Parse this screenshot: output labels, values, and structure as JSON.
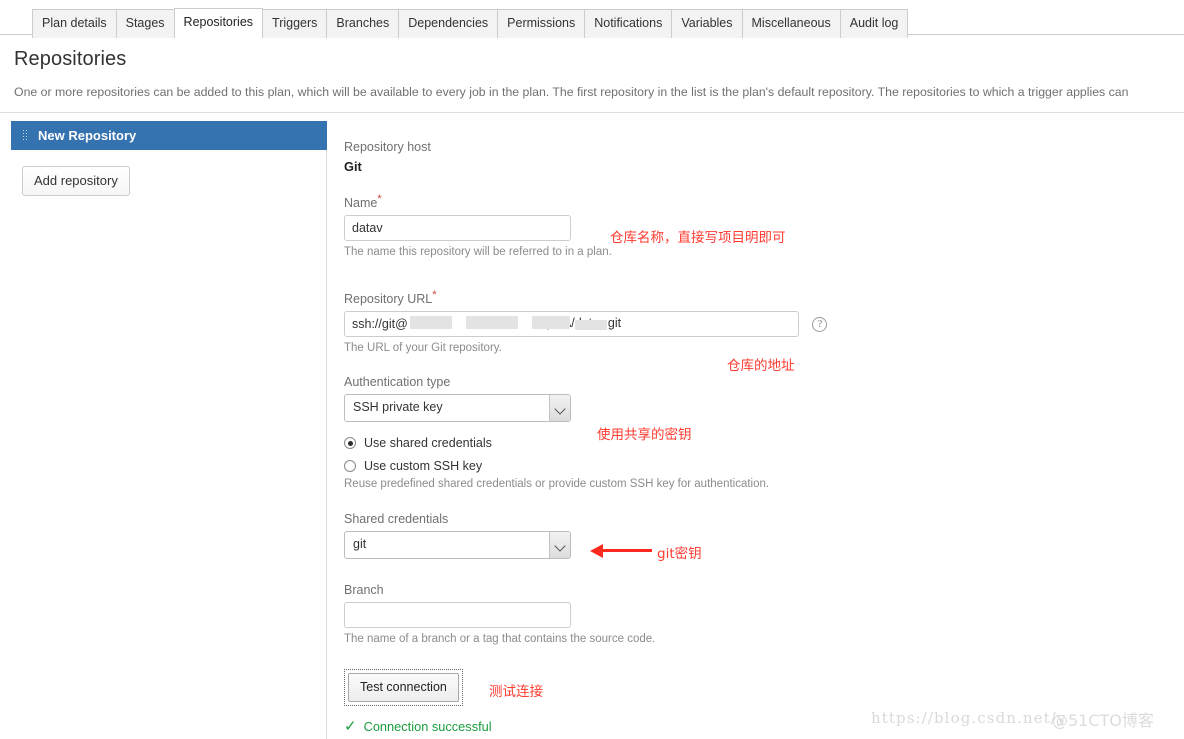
{
  "tabs": [
    {
      "label": "Plan details",
      "active": false
    },
    {
      "label": "Stages",
      "active": false
    },
    {
      "label": "Repositories",
      "active": true
    },
    {
      "label": "Triggers",
      "active": false
    },
    {
      "label": "Branches",
      "active": false
    },
    {
      "label": "Dependencies",
      "active": false
    },
    {
      "label": "Permissions",
      "active": false
    },
    {
      "label": "Notifications",
      "active": false
    },
    {
      "label": "Variables",
      "active": false
    },
    {
      "label": "Miscellaneous",
      "active": false
    },
    {
      "label": "Audit log",
      "active": false
    }
  ],
  "page": {
    "title": "Repositories",
    "description": "One or more repositories can be added to this plan, which will be available to every job in the plan. The first repository in the list is the plan's default repository. The repositories to which a trigger applies can"
  },
  "sidebar": {
    "repository_name": "New Repository",
    "add_button": "Add repository",
    "grip_icon": "drag-handle-icon"
  },
  "form": {
    "host_label": "Repository host",
    "host_value": "Git",
    "name_label": "Name",
    "name_required": "*",
    "name_value": "datav",
    "name_help": "The name this repository will be referred to in a plan.",
    "url_label": "Repository URL",
    "url_required": "*",
    "url_value_prefix": "ssh://git@",
    "url_value_suffix": ")/BA/datav.git",
    "url_help": "The URL of your Git repository.",
    "url_help_icon": "question-circle-icon",
    "auth_label": "Authentication type",
    "auth_value": "SSH private key",
    "radio_shared": "Use shared credentials",
    "radio_custom": "Use custom SSH key",
    "radio_selected": "Use shared credentials",
    "auth_help": "Reuse predefined shared credentials or provide custom SSH key for authentication.",
    "shared_label": "Shared credentials",
    "shared_value": "git",
    "branch_label": "Branch",
    "branch_value": "",
    "branch_help": "The name of a branch or a tag that contains the source code.",
    "test_button": "Test connection",
    "connection_status": "Connection successful",
    "connection_check_icon": "check-icon",
    "status_color": "#1a9d3f"
  },
  "annotations": {
    "name": "仓库名称，直接写项目明即可",
    "url": "仓库的地址",
    "auth": "使用共享的密钥",
    "credentials": "git密钥",
    "test": "测试连接",
    "color": "#ff3b30"
  },
  "watermark": {
    "url": "https://blog.csdn.net/y",
    "cto": "@51CTO博客"
  }
}
